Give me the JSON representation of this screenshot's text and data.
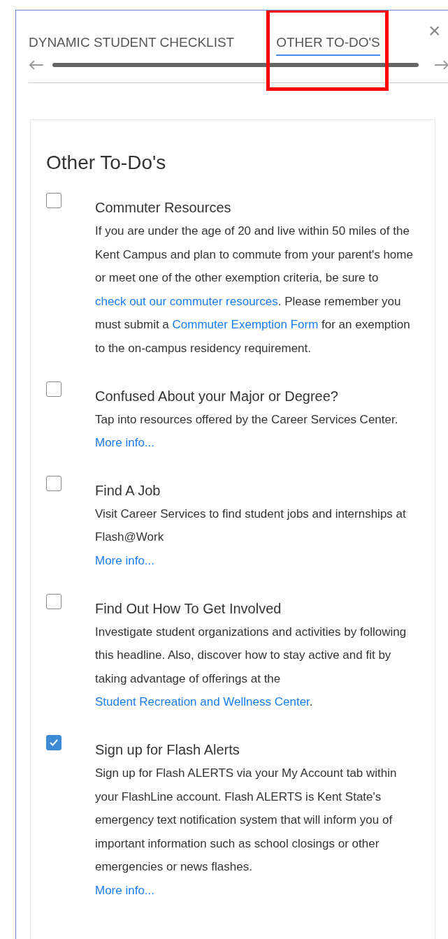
{
  "tabs": [
    {
      "label": "DYNAMIC STUDENT CHECKLIST",
      "selected": false,
      "highlighted": false
    },
    {
      "label": "OTHER TO-DO'S",
      "selected": true,
      "highlighted": true
    }
  ],
  "close_label": "×",
  "heading": "Other To-Do's",
  "items": [
    {
      "title": "Commuter Resources",
      "checked": false,
      "description": [
        {
          "text": "If you are under the age of 20 and live within 50 miles of the Kent Campus and plan to commute from your parent's home or meet one of the other exemption criteria, be sure to ",
          "link": false
        },
        {
          "text": "check out our commuter resources",
          "link": true
        },
        {
          "text": ". Please remember you must submit a ",
          "link": false
        },
        {
          "text": "Commuter Exemption Form",
          "link": true
        },
        {
          "text": " for an exemption to the on-campus residency requirement.",
          "link": false
        }
      ]
    },
    {
      "title": "Confused About your Major or Degree?",
      "checked": false,
      "description": [
        {
          "text": "Tap into resources offered by the Career Services Center.",
          "link": false
        }
      ],
      "more_link": "More info..."
    },
    {
      "title": "Find A Job",
      "checked": false,
      "description": [
        {
          "text": "Visit Career Services to find student jobs and internships at Flash@Work",
          "link": false
        }
      ],
      "more_link": "More info..."
    },
    {
      "title": "Find Out How To Get Involved",
      "checked": false,
      "description": [
        {
          "text": "Investigate student organizations and activities by following this headline. Also, discover how to stay active and fit by taking advantage of offerings at the ",
          "link": false
        },
        {
          "text": "Student Recreation and Wellness Center",
          "link": true
        },
        {
          "text": ".",
          "link": false
        }
      ]
    },
    {
      "title": "Sign up for Flash Alerts",
      "checked": true,
      "description": [
        {
          "text": "Sign up for Flash ALERTS via your My Account tab within your FlashLine account. Flash ALERTS is Kent State's emergency text notification system that will inform you of important information such as school closings or other emergencies or news flashes.",
          "link": false
        }
      ],
      "more_link": "More info..."
    }
  ]
}
